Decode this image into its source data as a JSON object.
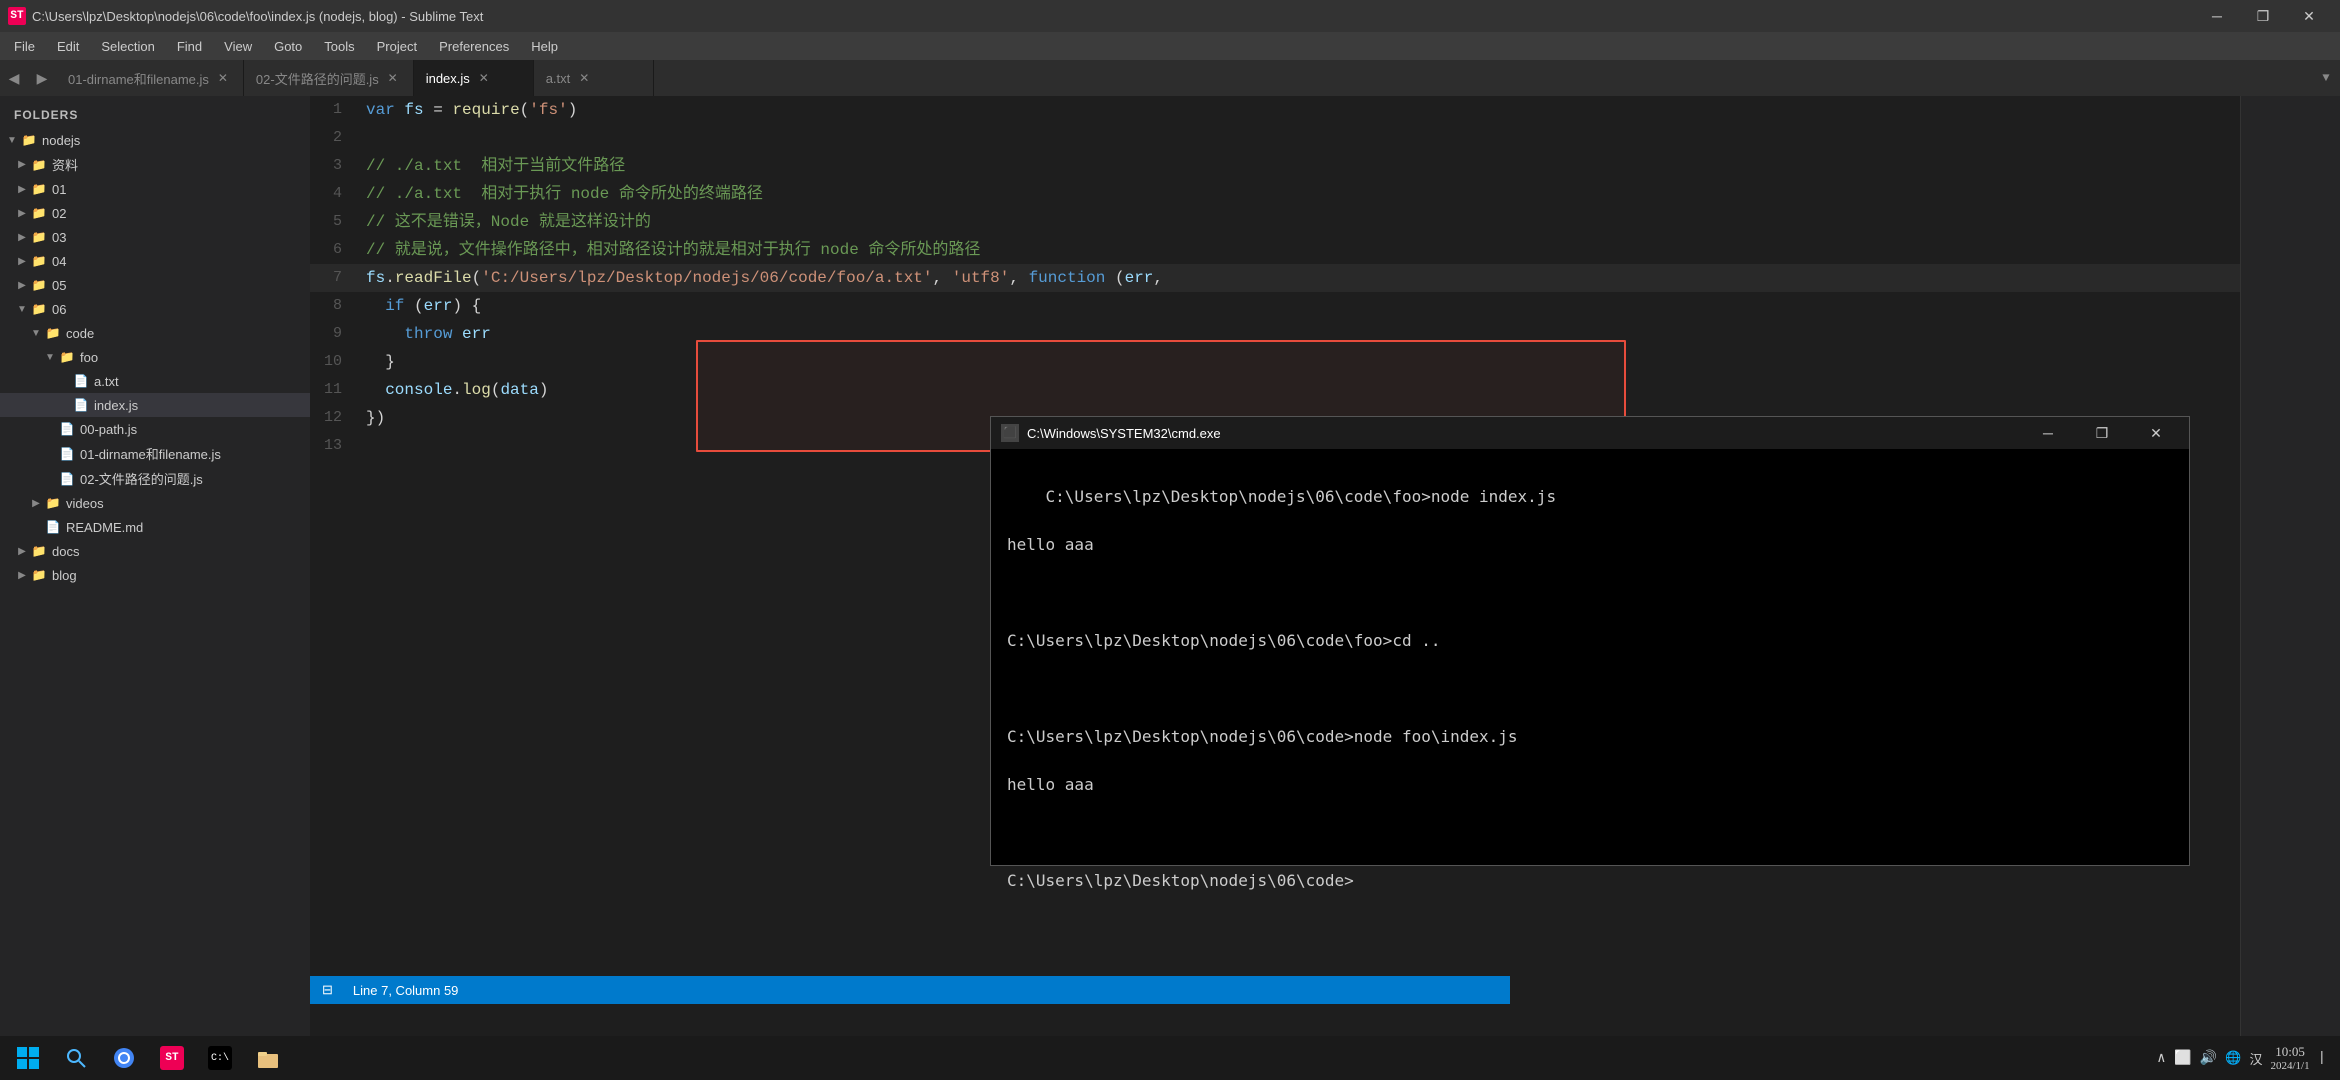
{
  "titlebar": {
    "icon": "ST",
    "title": "C:\\Users\\lpz\\Desktop\\nodejs\\06\\code\\foo\\index.js (nodejs, blog) - Sublime Text",
    "minimize": "─",
    "restore": "❐",
    "close": "✕"
  },
  "menu": {
    "items": [
      "File",
      "Edit",
      "Selection",
      "Find",
      "View",
      "Goto",
      "Tools",
      "Project",
      "Preferences",
      "Help"
    ]
  },
  "tabs": [
    {
      "id": "tab1",
      "label": "01-dirname和filename.js",
      "active": false
    },
    {
      "id": "tab2",
      "label": "02-文件路径的问题.js",
      "active": false
    },
    {
      "id": "tab3",
      "label": "index.js",
      "active": true
    },
    {
      "id": "tab4",
      "label": "a.txt",
      "active": false
    }
  ],
  "sidebar": {
    "title": "FOLDERS",
    "tree": [
      {
        "indent": 0,
        "arrow": "▼",
        "icon": "📁",
        "label": "nodejs",
        "type": "folder-open"
      },
      {
        "indent": 1,
        "arrow": "▶",
        "icon": "📁",
        "label": "资料",
        "type": "folder"
      },
      {
        "indent": 1,
        "arrow": "▶",
        "icon": "📁",
        "label": "01",
        "type": "folder"
      },
      {
        "indent": 1,
        "arrow": "▶",
        "icon": "📁",
        "label": "02",
        "type": "folder"
      },
      {
        "indent": 1,
        "arrow": "▶",
        "icon": "📁",
        "label": "03",
        "type": "folder"
      },
      {
        "indent": 1,
        "arrow": "▶",
        "icon": "📁",
        "label": "04",
        "type": "folder"
      },
      {
        "indent": 1,
        "arrow": "▶",
        "icon": "📁",
        "label": "05",
        "type": "folder"
      },
      {
        "indent": 1,
        "arrow": "▼",
        "icon": "📁",
        "label": "06",
        "type": "folder-open"
      },
      {
        "indent": 2,
        "arrow": "▼",
        "icon": "📁",
        "label": "code",
        "type": "folder-open"
      },
      {
        "indent": 3,
        "arrow": "▼",
        "icon": "📁",
        "label": "foo",
        "type": "folder-open"
      },
      {
        "indent": 4,
        "arrow": " ",
        "icon": "📄",
        "label": "a.txt",
        "type": "file-txt"
      },
      {
        "indent": 4,
        "arrow": " ",
        "icon": "📄",
        "label": "index.js",
        "type": "file-js",
        "selected": true
      },
      {
        "indent": 3,
        "arrow": " ",
        "icon": "📄",
        "label": "00-path.js",
        "type": "file-js"
      },
      {
        "indent": 3,
        "arrow": " ",
        "icon": "📄",
        "label": "01-dirname和filename.js",
        "type": "file-js"
      },
      {
        "indent": 3,
        "arrow": " ",
        "icon": "📄",
        "label": "02-文件路径的问题.js",
        "type": "file-js"
      },
      {
        "indent": 2,
        "arrow": "▶",
        "icon": "📁",
        "label": "videos",
        "type": "folder"
      },
      {
        "indent": 2,
        "arrow": " ",
        "icon": "📄",
        "label": "README.md",
        "type": "file-md"
      },
      {
        "indent": 1,
        "arrow": "▶",
        "icon": "📁",
        "label": "docs",
        "type": "folder"
      },
      {
        "indent": 1,
        "arrow": "▶",
        "icon": "📁",
        "label": "blog",
        "type": "folder"
      }
    ]
  },
  "code": {
    "lines": [
      {
        "num": 1,
        "content": "var fs = require('fs')"
      },
      {
        "num": 2,
        "content": ""
      },
      {
        "num": 3,
        "content": "// ./a.txt  相对于当前文件路径"
      },
      {
        "num": 4,
        "content": "// ./a.txt  相对于执行 node 命令所处的终端路径"
      },
      {
        "num": 5,
        "content": "// 这不是错误，Node 就是这样设计的"
      },
      {
        "num": 6,
        "content": "// 就是说，文件操作路径中，相对路径设计的就是相对于执行 node 命令所处的路径"
      },
      {
        "num": 7,
        "content": "fs.readFile('C:/Users/lpz/Desktop/nodejs/06/code/foo/a.txt', 'utf8', function (err,"
      },
      {
        "num": 8,
        "content": "  if (err) {"
      },
      {
        "num": 9,
        "content": "    throw err"
      },
      {
        "num": 10,
        "content": "  }"
      },
      {
        "num": 11,
        "content": "  console.log(data)"
      },
      {
        "num": 12,
        "content": "})"
      },
      {
        "num": 13,
        "content": ""
      }
    ]
  },
  "redbox": {
    "label": "red highlight box around lines 7-9"
  },
  "cmd": {
    "title": "C:\\Windows\\SYSTEM32\\cmd.exe",
    "lines": [
      "C:\\Users\\lpz\\Desktop\\nodejs\\06\\code\\foo>node index.js",
      "hello aaa",
      "",
      "C:\\Users\\lpz\\Desktop\\nodejs\\06\\code\\foo>cd ..",
      "",
      "C:\\Users\\lpz\\Desktop\\nodejs\\06\\code>node foo\\index.js",
      "hello aaa",
      "",
      "C:\\Users\\lpz\\Desktop\\nodejs\\06\\code>"
    ]
  },
  "statusbar": {
    "position": "Line 7, Column 59"
  },
  "taskbar": {
    "items": [
      "⊞",
      "🌐",
      "📁",
      "💻",
      "🗂️"
    ],
    "rightItems": [
      "∧",
      "⬛",
      "🔊",
      "🌐",
      "汉",
      "10:05",
      "2024/1/1"
    ]
  }
}
